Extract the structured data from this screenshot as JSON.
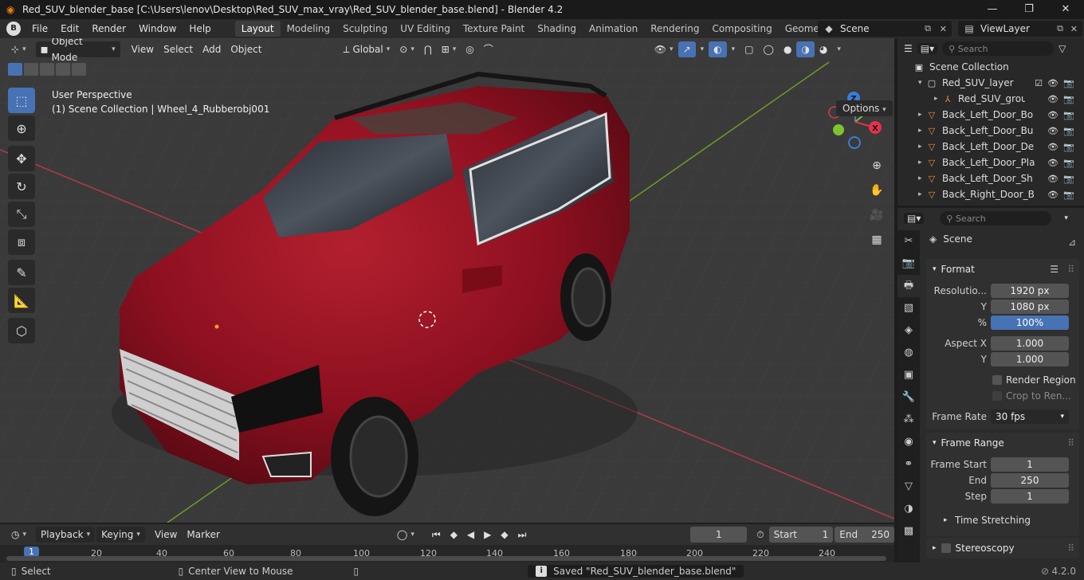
{
  "window": {
    "title": "Red_SUV_blender_base [C:\\Users\\lenov\\Desktop\\Red_SUV_max_vray\\Red_SUV_blender_base.blend] - Blender 4.2",
    "minimize": "—",
    "maximize": "❐",
    "close": "✕"
  },
  "menu": [
    "File",
    "Edit",
    "Render",
    "Window",
    "Help"
  ],
  "workspaces": [
    "Layout",
    "Modeling",
    "Sculpting",
    "UV Editing",
    "Texture Paint",
    "Shading",
    "Animation",
    "Rendering",
    "Compositing",
    "Geometry Nod"
  ],
  "scene_name": "Scene",
  "view_layer": "ViewLayer",
  "viewport": {
    "mode": "Object Mode",
    "menus": [
      "View",
      "Select",
      "Add",
      "Object"
    ],
    "orientation": "Global",
    "options": "Options",
    "perspective": "User Perspective",
    "collection_info": "(1) Scene Collection | Wheel_4_Rubberobj001",
    "gizmo": {
      "x": "X",
      "y": "Y",
      "z": "Z"
    }
  },
  "outliner": {
    "search_placeholder": "Search",
    "root": "Scene Collection",
    "items": [
      "Red_SUV_layer",
      "Red_SUV_group",
      "Back_Left_Door_Bo",
      "Back_Left_Door_Bu",
      "Back_Left_Door_De",
      "Back_Left_Door_Pla",
      "Back_Left_Door_Sh",
      "Back_Right_Door_B"
    ]
  },
  "properties": {
    "search_placeholder": "Search",
    "context": "Scene",
    "format": {
      "title": "Format",
      "resolution_label": "Resolutio...",
      "resolution_x": "1920 px",
      "y_label": "Y",
      "resolution_y": "1080 px",
      "percent_label": "%",
      "percent": "100%",
      "aspect_x_label": "Aspect X",
      "aspect_x": "1.000",
      "aspect_y": "1.000",
      "render_region": "Render Region",
      "crop": "Crop to Ren...",
      "frame_rate_label": "Frame Rate",
      "frame_rate": "30 fps"
    },
    "frame_range": {
      "title": "Frame Range",
      "start_label": "Frame Start",
      "start": "1",
      "end_label": "End",
      "end": "250",
      "step_label": "Step",
      "step": "1",
      "time_stretching": "Time Stretching"
    },
    "stereoscopy": "Stereoscopy"
  },
  "timeline": {
    "menus": [
      "Playback",
      "Keying",
      "View",
      "Marker"
    ],
    "current_frame": "1",
    "start_label": "Start",
    "start": "1",
    "end_label": "End",
    "end": "250",
    "ticks": [
      "1",
      "20",
      "40",
      "60",
      "80",
      "100",
      "120",
      "140",
      "160",
      "180",
      "200",
      "220",
      "240"
    ]
  },
  "status": {
    "select": "Select",
    "center": "Center View to Mouse",
    "saved": "Saved \"Red_SUV_blender_base.blend\"",
    "version": "4.2.0"
  },
  "colors": {
    "accent": "#4772b3",
    "car_red": "#8e1020",
    "x_axis": "#e8304a",
    "y_axis": "#7ec22e",
    "z_axis": "#3b7cd6"
  }
}
